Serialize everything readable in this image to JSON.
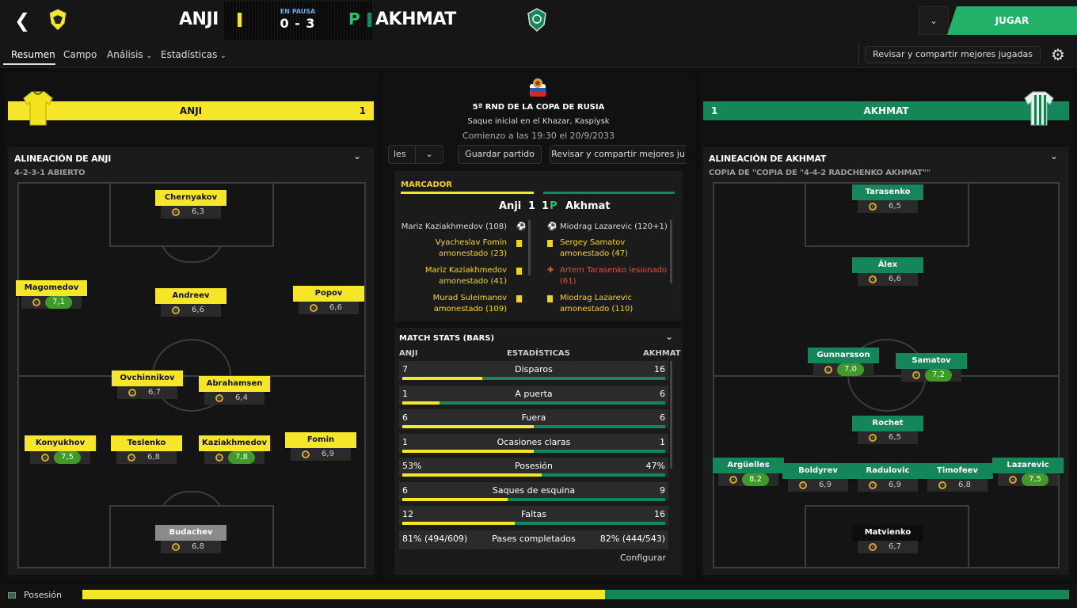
{
  "header": {
    "home_team": "ANJI",
    "away_team": "AKHMAT",
    "status": "EN PAUSA",
    "score": "0 - 3",
    "penalty_marker": "P",
    "play_button": "JUGAR",
    "dropdown_icon": "chevron-down-icon",
    "back_icon": "back-arrow-icon"
  },
  "nav": {
    "tabs": [
      "Resumen",
      "Campo",
      "Análisis",
      "Estadísticas"
    ],
    "review_label": "Revisar y compartir mejores jugadas",
    "gear_icon": "gear-icon"
  },
  "home": {
    "bar_name": "ANJI",
    "bar_score": "1",
    "color": "#f6e62a",
    "lineup_title": "ALINEACIÓN DE ANJI",
    "formation": "4-2-3-1 ABIERTO",
    "players": [
      {
        "name": "Chernyakov",
        "rating": "6,3",
        "good": false
      },
      {
        "name": "Magomedov",
        "rating": "7,1",
        "good": true
      },
      {
        "name": "Andreev",
        "rating": "6,6",
        "good": false
      },
      {
        "name": "Popov",
        "rating": "6,6",
        "good": false
      },
      {
        "name": "Ovchinnikov",
        "rating": "6,7",
        "good": false
      },
      {
        "name": "Abrahamsen",
        "rating": "6,4",
        "good": false
      },
      {
        "name": "Konyukhov",
        "rating": "7,5",
        "good": true
      },
      {
        "name": "Teslenko",
        "rating": "6,8",
        "good": false
      },
      {
        "name": "Kaziakhmedov",
        "rating": "7,8",
        "good": true
      },
      {
        "name": "Fomin",
        "rating": "6,9",
        "good": false
      },
      {
        "name": "Budachev",
        "rating": "6,8",
        "good": false
      }
    ]
  },
  "away": {
    "bar_name": "AKHMAT",
    "bar_score": "1",
    "color": "#15865a",
    "lineup_title": "ALINEACIÓN DE AKHMAT",
    "formation": "COPIA DE \"COPIA DE \"4-4-2 RADCHENKO AKHMAT\"\"",
    "players": [
      {
        "name": "Tarasenko",
        "rating": "6,5",
        "good": false
      },
      {
        "name": "Ālex",
        "rating": "6,6",
        "good": false
      },
      {
        "name": "Gunnarsson",
        "rating": "7,0",
        "good": true
      },
      {
        "name": "Samatov",
        "rating": "7,2",
        "good": true
      },
      {
        "name": "Rochet",
        "rating": "6,5",
        "good": false
      },
      {
        "name": "Argüelles",
        "rating": "8,2",
        "good": true
      },
      {
        "name": "Boldyrev",
        "rating": "6,9",
        "good": false
      },
      {
        "name": "Radulovic",
        "rating": "6,9",
        "good": false
      },
      {
        "name": "Timofeev",
        "rating": "6,8",
        "good": false
      },
      {
        "name": "Lazarevic",
        "rating": "7,5",
        "good": true
      },
      {
        "name": "Matvienko",
        "rating": "6,7",
        "good": false
      }
    ]
  },
  "match": {
    "round": "5ª RND DE LA COPA DE RUSIA",
    "kickoff": "Saque inicial en el Khazar, Kaspiysk",
    "start": "Comienzo a las 19:30 el 20/9/2033",
    "btn_partial": "les",
    "save_btn": "Guardar partido",
    "review_btn": "Revisar y compartir mejores ju"
  },
  "scoreboard": {
    "title": "MARCADOR",
    "home": "Anji",
    "home_score": "1",
    "away_score": "1",
    "penalty": "P",
    "away": "Akhmat",
    "home_events": [
      {
        "text": "Mariz Kaziakhmedov (108)",
        "type": "goal"
      },
      {
        "text": "Vyacheslav Fomin amonestado (23)",
        "type": "yellow"
      },
      {
        "text": "Mariz Kaziakhmedov amonestado (41)",
        "type": "yellow"
      },
      {
        "text": "Murad Suleimanov amonestado (109)",
        "type": "yellow"
      }
    ],
    "away_events": [
      {
        "text": "Miodrag Lazarevic (120+1)",
        "type": "goal"
      },
      {
        "text": "Sergey Samatov amonestado (47)",
        "type": "yellow"
      },
      {
        "text": "Artem Tarasenko lesionado (61)",
        "type": "injury"
      },
      {
        "text": "Miodrag Lazarevic amonestado (110)",
        "type": "yellow"
      }
    ]
  },
  "stats": {
    "title": "MATCH STATS (BARS)",
    "col_home": "ANJI",
    "col_mid": "ESTADÍSTICAS",
    "col_away": "AKHMAT",
    "rows": [
      {
        "label": "Disparos",
        "home": "7",
        "away": "16",
        "home_share": 0.304
      },
      {
        "label": "A puerta",
        "home": "1",
        "away": "6",
        "home_share": 0.143
      },
      {
        "label": "Fuera",
        "home": "6",
        "away": "6",
        "home_share": 0.5
      },
      {
        "label": "Ocasiones claras",
        "home": "1",
        "away": "1",
        "home_share": 0.5
      },
      {
        "label": "Posesión",
        "home": "53%",
        "away": "47%",
        "home_share": 0.53
      },
      {
        "label": "Saques de esquina",
        "home": "6",
        "away": "9",
        "home_share": 0.4
      },
      {
        "label": "Faltas",
        "home": "12",
        "away": "16",
        "home_share": 0.429
      }
    ],
    "passes_label": "Pases completados",
    "passes_home": "81% (494/609)",
    "passes_away": "82% (444/543)",
    "configure_btn": "Configurar"
  },
  "footer": {
    "label": "Posesión",
    "home_share": 0.53
  }
}
